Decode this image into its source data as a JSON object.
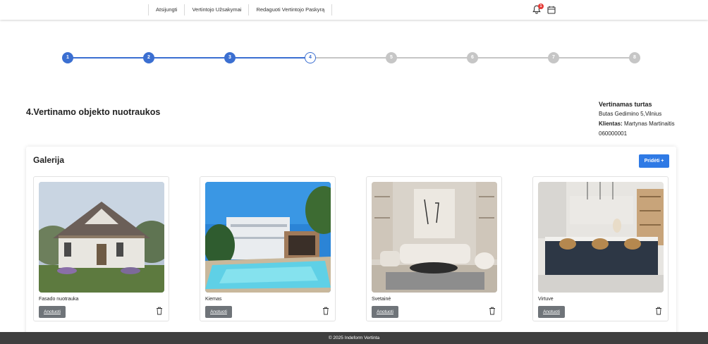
{
  "nav": {
    "items": [
      "Atsijungti",
      "Vertintojo Užsakymai",
      "Redaguoti Vertintojo Paskyrą"
    ],
    "notification_count": "1",
    "icons": [
      "bell-icon",
      "calendar-icon"
    ]
  },
  "stepper": {
    "steps": [
      "1",
      "2",
      "3",
      "4",
      "5",
      "6",
      "7",
      "8"
    ],
    "current": 4,
    "colors": {
      "done": "#3b6fd1",
      "todo": "#c6c6c6"
    }
  },
  "section_title": "4.Vertinamo objekto nuotraukos",
  "property": {
    "heading": "Vertinamas turtas",
    "address": "Butas Gedimino 5,Vilnius",
    "client_label": "Klientas:",
    "client_name": "Martynas Martinaitis",
    "phone": "060000001"
  },
  "gallery": {
    "title": "Galerija",
    "add_label": "Pridėti +",
    "photos": [
      {
        "caption": "Fasado nuotrauka",
        "annotate_label": "Anotuoti"
      },
      {
        "caption": "Kiemas",
        "annotate_label": "Anotuoti"
      },
      {
        "caption": "Svetainė",
        "annotate_label": "Anotuoti"
      },
      {
        "caption": "Virtuve",
        "annotate_label": "Anotuoti"
      }
    ]
  },
  "footer": {
    "text": "© 2025 Indeform Vertinta"
  },
  "colors": {
    "accent": "#2f7ae5",
    "footer": "#3f3f3f",
    "annotate_button": "#6f7479"
  }
}
